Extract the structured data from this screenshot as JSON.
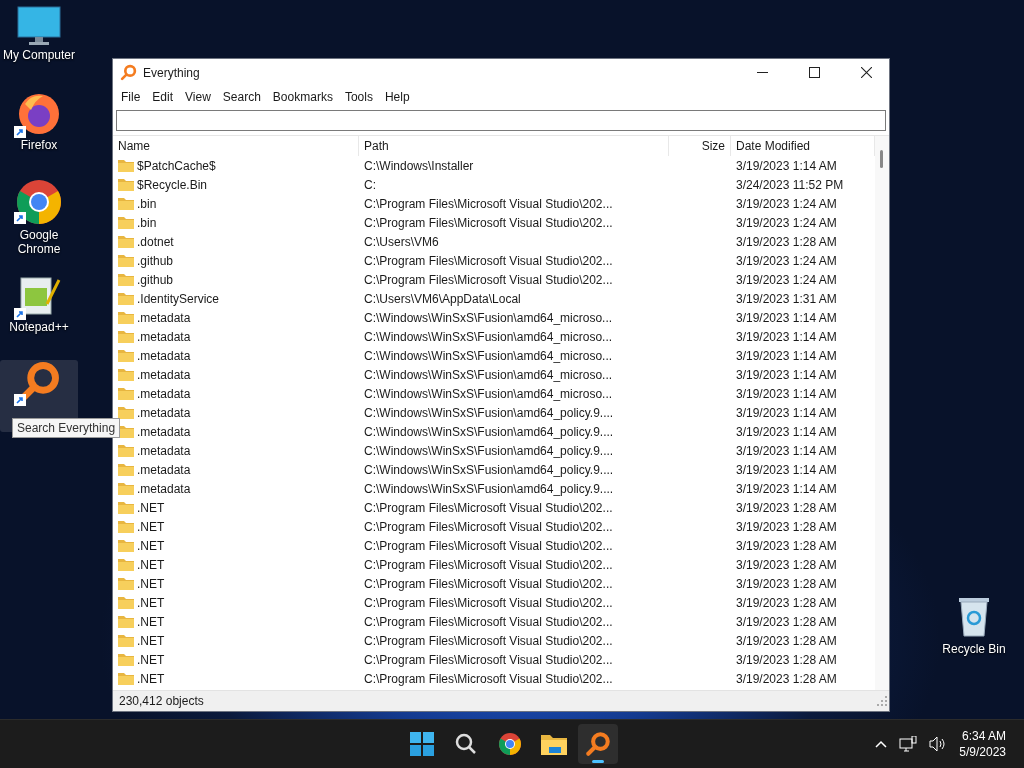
{
  "desktop_icons": [
    {
      "label": "My Computer",
      "kind": "computer",
      "shortcut": false,
      "hovered": false
    },
    {
      "label": "Firefox",
      "kind": "firefox",
      "shortcut": true,
      "hovered": false
    },
    {
      "label": "Google Chrome",
      "kind": "chrome",
      "shortcut": true,
      "hovered": false
    },
    {
      "label": "Notepad++",
      "kind": "notepad",
      "shortcut": true,
      "hovered": false
    },
    {
      "kind": "everything",
      "shortcut": true,
      "hovered": true,
      "tooltip": "Search Everything"
    }
  ],
  "recycle_bin": {
    "label": "Recycle Bin"
  },
  "window": {
    "title": "Everything"
  },
  "menu": [
    "File",
    "Edit",
    "View",
    "Search",
    "Bookmarks",
    "Tools",
    "Help"
  ],
  "table": {
    "columns": [
      {
        "label": "Name",
        "kind": "text"
      },
      {
        "label": "Path",
        "kind": "text"
      },
      {
        "label": "Size",
        "kind": "number"
      },
      {
        "label": "Date Modified",
        "kind": "text"
      }
    ],
    "rows": [
      {
        "name": "$PatchCache$",
        "path": "C:\\Windows\\Installer",
        "date": "3/19/2023 1:14 AM"
      },
      {
        "name": "$Recycle.Bin",
        "path": "C:",
        "date": "3/24/2023 11:52 PM"
      },
      {
        "name": ".bin",
        "path": "C:\\Program Files\\Microsoft Visual Studio\\202...",
        "date": "3/19/2023 1:24 AM"
      },
      {
        "name": ".bin",
        "path": "C:\\Program Files\\Microsoft Visual Studio\\202...",
        "date": "3/19/2023 1:24 AM"
      },
      {
        "name": ".dotnet",
        "path": "C:\\Users\\VM6",
        "date": "3/19/2023 1:28 AM"
      },
      {
        "name": ".github",
        "path": "C:\\Program Files\\Microsoft Visual Studio\\202...",
        "date": "3/19/2023 1:24 AM"
      },
      {
        "name": ".github",
        "path": "C:\\Program Files\\Microsoft Visual Studio\\202...",
        "date": "3/19/2023 1:24 AM"
      },
      {
        "name": ".IdentityService",
        "path": "C:\\Users\\VM6\\AppData\\Local",
        "date": "3/19/2023 1:31 AM"
      },
      {
        "name": ".metadata",
        "path": "C:\\Windows\\WinSxS\\Fusion\\amd64_microso...",
        "date": "3/19/2023 1:14 AM"
      },
      {
        "name": ".metadata",
        "path": "C:\\Windows\\WinSxS\\Fusion\\amd64_microso...",
        "date": "3/19/2023 1:14 AM"
      },
      {
        "name": ".metadata",
        "path": "C:\\Windows\\WinSxS\\Fusion\\amd64_microso...",
        "date": "3/19/2023 1:14 AM"
      },
      {
        "name": ".metadata",
        "path": "C:\\Windows\\WinSxS\\Fusion\\amd64_microso...",
        "date": "3/19/2023 1:14 AM"
      },
      {
        "name": ".metadata",
        "path": "C:\\Windows\\WinSxS\\Fusion\\amd64_microso...",
        "date": "3/19/2023 1:14 AM"
      },
      {
        "name": ".metadata",
        "path": "C:\\Windows\\WinSxS\\Fusion\\amd64_policy.9....",
        "date": "3/19/2023 1:14 AM"
      },
      {
        "name": ".metadata",
        "path": "C:\\Windows\\WinSxS\\Fusion\\amd64_policy.9....",
        "date": "3/19/2023 1:14 AM"
      },
      {
        "name": ".metadata",
        "path": "C:\\Windows\\WinSxS\\Fusion\\amd64_policy.9....",
        "date": "3/19/2023 1:14 AM"
      },
      {
        "name": ".metadata",
        "path": "C:\\Windows\\WinSxS\\Fusion\\amd64_policy.9....",
        "date": "3/19/2023 1:14 AM"
      },
      {
        "name": ".metadata",
        "path": "C:\\Windows\\WinSxS\\Fusion\\amd64_policy.9....",
        "date": "3/19/2023 1:14 AM"
      },
      {
        "name": ".NET",
        "path": "C:\\Program Files\\Microsoft Visual Studio\\202...",
        "date": "3/19/2023 1:28 AM"
      },
      {
        "name": ".NET",
        "path": "C:\\Program Files\\Microsoft Visual Studio\\202...",
        "date": "3/19/2023 1:28 AM"
      },
      {
        "name": ".NET",
        "path": "C:\\Program Files\\Microsoft Visual Studio\\202...",
        "date": "3/19/2023 1:28 AM"
      },
      {
        "name": ".NET",
        "path": "C:\\Program Files\\Microsoft Visual Studio\\202...",
        "date": "3/19/2023 1:28 AM"
      },
      {
        "name": ".NET",
        "path": "C:\\Program Files\\Microsoft Visual Studio\\202...",
        "date": "3/19/2023 1:28 AM"
      },
      {
        "name": ".NET",
        "path": "C:\\Program Files\\Microsoft Visual Studio\\202...",
        "date": "3/19/2023 1:28 AM"
      },
      {
        "name": ".NET",
        "path": "C:\\Program Files\\Microsoft Visual Studio\\202...",
        "date": "3/19/2023 1:28 AM"
      },
      {
        "name": ".NET",
        "path": "C:\\Program Files\\Microsoft Visual Studio\\202...",
        "date": "3/19/2023 1:28 AM"
      },
      {
        "name": ".NET",
        "path": "C:\\Program Files\\Microsoft Visual Studio\\202...",
        "date": "3/19/2023 1:28 AM"
      },
      {
        "name": ".NET",
        "path": "C:\\Program Files\\Microsoft Visual Studio\\202...",
        "date": "3/19/2023 1:28 AM"
      }
    ]
  },
  "status_bar": {
    "text": "230,412 objects"
  },
  "taskbar": {
    "apps": [
      {
        "kind": "start",
        "selected": false
      },
      {
        "kind": "search",
        "selected": false
      },
      {
        "kind": "chrome",
        "selected": false
      },
      {
        "kind": "explorer",
        "selected": false
      },
      {
        "kind": "everything",
        "selected": true
      }
    ],
    "clock": {
      "time": "6:34 AM",
      "date": "5/9/2023"
    }
  }
}
